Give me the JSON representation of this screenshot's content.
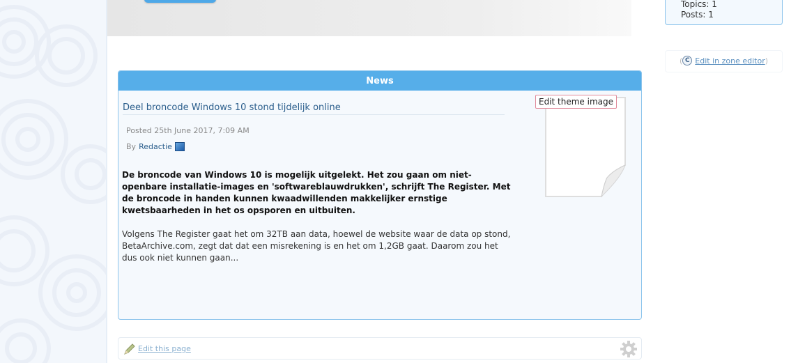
{
  "stats": {
    "topics": "Topics:  1",
    "posts": "Posts:  1"
  },
  "zone_editor": {
    "icon": "c-icon",
    "link": "Edit in zone editor"
  },
  "news": {
    "heading": "News",
    "article_title": "Deel broncode Windows 10 stond tijdelijk online",
    "posted": "Posted 25th June 2017, 7:09 AM",
    "by_label": "By",
    "author": "Redactie",
    "lead": "De broncode van Windows 10 is mogelijk uitgelekt. Het zou gaan om niet-openbare installatie-images en 'softwareblauwdrukken', schrijft The Register. Met de broncode in handen kunnen kwaadwillenden makkelijker ernstige kwetsbaarheden in het os opsporen en uitbuiten.",
    "body": "Volgens The Register gaat het om 32TB aan data, hoewel de website waar de data op stond, BetaArchive.com, zegt dat dat een misrekening is en het om 1,2GB gaat. Daarom zou het dus ook niet kunnen gaan...",
    "theme_image_label": "Edit theme image"
  },
  "footer": {
    "edit_page_link": "Edit this page"
  },
  "colors": {
    "accent": "#56aee9",
    "link": "#2b5e8c",
    "border": "#8cc4ec"
  }
}
